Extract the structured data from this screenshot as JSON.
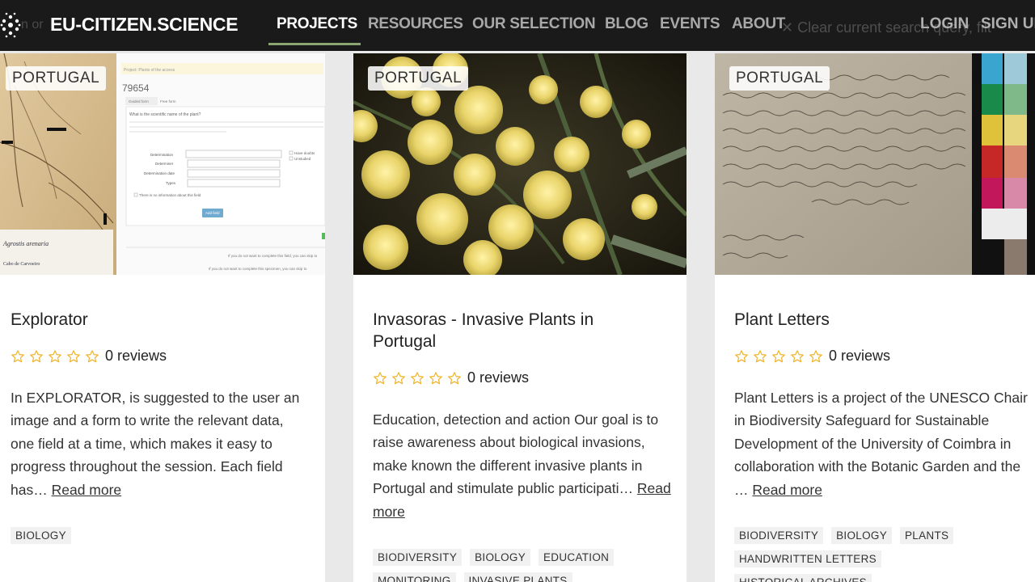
{
  "nav": {
    "brand": "EU-CITIZEN.SCIENCE",
    "ghost_text": "n or",
    "links": [
      "PROJECTS",
      "RESOURCES",
      "OUR SELECTION",
      "BLOG",
      "EVENTS",
      "ABOUT"
    ],
    "clear_search": "Clear current search query, filt",
    "login": "LOGIN",
    "signup": "SIGN UP"
  },
  "colors": {
    "nav_bg": "#1a1a1a",
    "active_underline": "#8aa572",
    "star": "#f0b429"
  },
  "cards": [
    {
      "country": "PORTUGAL",
      "title": "Explorator",
      "reviews": "0 reviews",
      "rating": 0,
      "description": "In EXPLORATOR, is suggested to the user an image and a form to write the relevant data, one field at a time, which makes it easy to progress throughout the session. Each field has…",
      "read_more": "Read more",
      "tags": [
        "BIOLOGY"
      ],
      "image_text": {
        "form_header": "Project: Plants of the access",
        "form_number": "79654",
        "tab1": "Guided form",
        "tab2": "Free form",
        "question": "What is the scientific name of the plant?",
        "field1": "Determination",
        "field2": "Determiner",
        "field3": "Determination date",
        "field4": "Types",
        "check1": "Have doubts",
        "check2": "Unstudied",
        "checkbox_label": "There is no information about this field",
        "button": "Add field",
        "footer1": "If you do not want to complete this field, you can skip to",
        "footer2": "If you do not want to complete this specimen, you can skip to",
        "label_handwriting": "Agrostis arenaria",
        "label_bottom": "Cabo de Carvoeiro"
      }
    },
    {
      "country": "PORTUGAL",
      "title": "Invasoras - Invasive Plants in Portugal",
      "reviews": "0 reviews",
      "rating": 0,
      "description": "Education, detection and action Our goal is to raise awareness about biological invasions, make known the different invasive plants in Portugal and stimulate public participati…",
      "read_more": "Read more",
      "tags": [
        "BIODIVERSITY",
        "BIOLOGY",
        "EDUCATION",
        "MONITORING",
        "INVASIVE PLANTS"
      ]
    },
    {
      "country": "PORTUGAL",
      "title": "Plant Letters",
      "reviews": "0 reviews",
      "rating": 0,
      "description": "Plant Letters is a project of the UNESCO Chair in Biodiversity Safeguard for Sustainable Development of the University of Coimbra in collaboration with the Botanic Garden and the …",
      "read_more": "Read more",
      "tags": [
        "BIODIVERSITY",
        "BIOLOGY",
        "PLANTS",
        "HANDWRITTEN LETTERS",
        "HISTORICAL ARCHIVES"
      ]
    }
  ]
}
